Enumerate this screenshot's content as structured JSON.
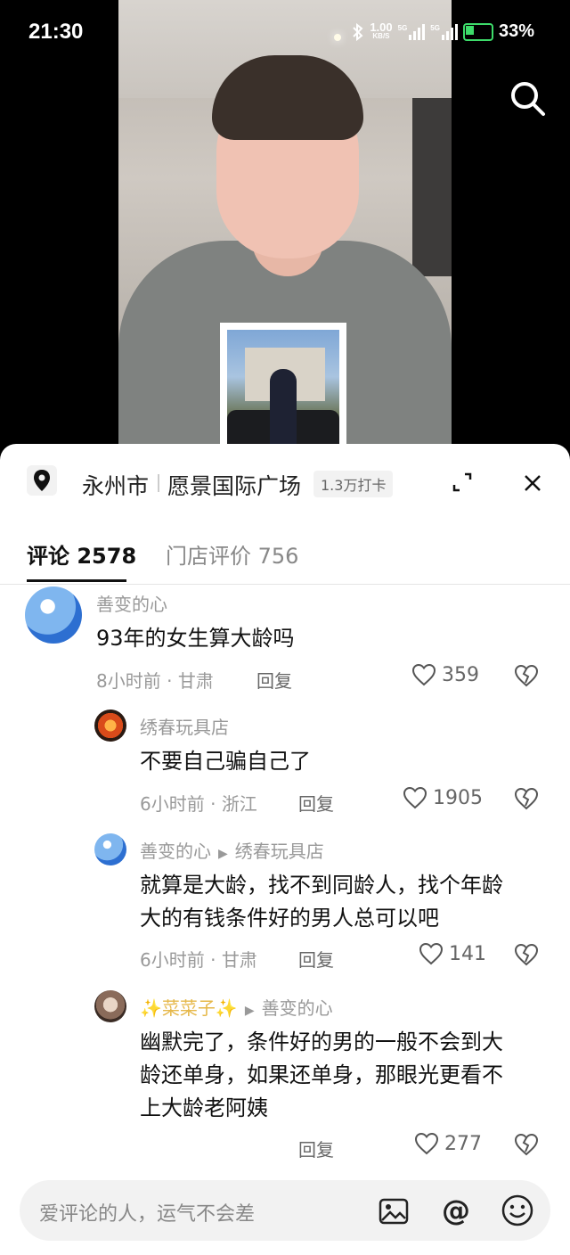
{
  "status_bar": {
    "time": "21:30",
    "net_speed": "1.00",
    "net_unit": "KB/S",
    "sig1": "5G",
    "sig2": "5G",
    "battery": "33%"
  },
  "location": {
    "city": "永州市",
    "place": "愿景国际广场",
    "checkins": "1.3万打卡"
  },
  "tabs": [
    {
      "label": "评论 2578",
      "active": true
    },
    {
      "label": "门店评价 756",
      "active": false
    }
  ],
  "comments": [
    {
      "user": "善变的心",
      "text": "93年的女生算大龄吗",
      "time": "8小时前",
      "region": "甘肃",
      "reply": "回复",
      "likes": "359",
      "avatar": "sky"
    },
    {
      "user": "绣春玩具店",
      "text": "不要自己骗自己了",
      "time": "6小时前",
      "region": "浙江",
      "reply": "回复",
      "likes": "1905",
      "avatar": "flame"
    },
    {
      "user": "善变的心",
      "reply_to": "绣春玩具店",
      "text_lines": [
        "就算是大龄，找不到同龄人，找个年龄",
        "大的有钱条件好的男人总可以吧"
      ],
      "time": "6小时前",
      "region": "甘肃",
      "reply": "回复",
      "likes": "141",
      "avatar": "sky"
    },
    {
      "user": "✨菜菜子✨",
      "reply_to": "善变的心",
      "text_lines": [
        "幽默完了，条件好的男的一般不会到大",
        "龄还单身，如果还单身，那眼光更看不",
        "上大龄老阿姨"
      ],
      "reply": "回复",
      "likes": "277",
      "avatar": "cat"
    }
  ],
  "input": {
    "placeholder": "爱评论的人，运气不会差",
    "at_symbol": "@"
  },
  "icons": {
    "search": "search-icon",
    "location": "location-pin-icon",
    "expand": "expand-icon",
    "close": "close-icon",
    "like": "heart-icon",
    "dislike": "broken-heart-icon",
    "image": "image-icon",
    "emoji": "emoji-icon"
  },
  "colors": {
    "battery": "#3ddc6a",
    "text_primary": "#111111",
    "text_secondary": "#999999"
  }
}
